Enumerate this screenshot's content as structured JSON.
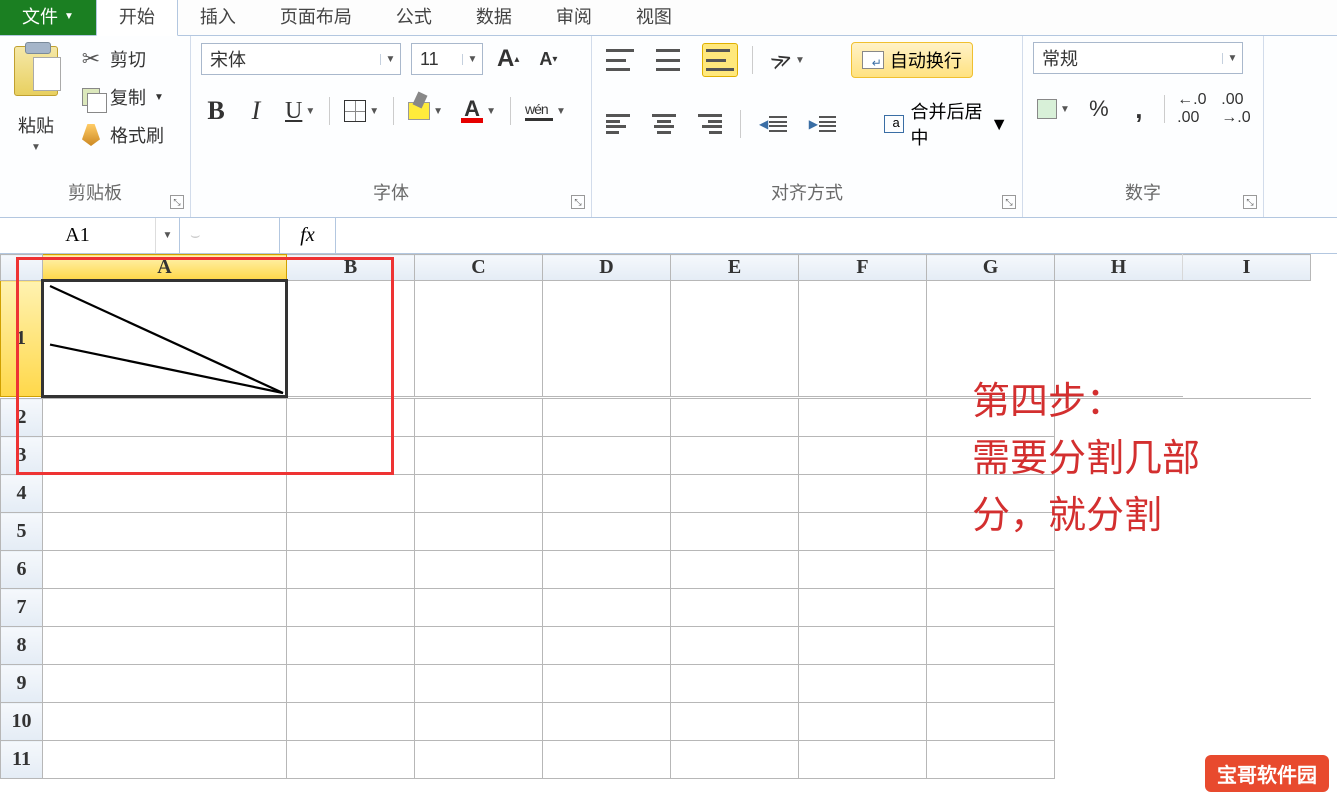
{
  "tabs": {
    "file": "文件",
    "items": [
      "开始",
      "插入",
      "页面布局",
      "公式",
      "数据",
      "审阅",
      "视图"
    ],
    "active_index": 0
  },
  "ribbon": {
    "clipboard": {
      "label": "剪贴板",
      "paste": "粘贴",
      "cut": "剪切",
      "copy": "复制",
      "format_painter": "格式刷"
    },
    "font": {
      "label": "字体",
      "name": "宋体",
      "size": "11",
      "bold": "B",
      "italic": "I",
      "underline": "U",
      "grow": "A",
      "shrink": "A",
      "fontcolor_letter": "A",
      "pinyin": "wén"
    },
    "align": {
      "label": "对齐方式",
      "wrap": "自动换行",
      "merge": "合并后居中"
    },
    "number": {
      "label": "数字",
      "format": "常规",
      "percent": "%",
      "comma": ",",
      "dec_inc": ".0 .00",
      "dec_dec": ".00 .0"
    }
  },
  "fxbar": {
    "namebox": "A1",
    "fx": "fx"
  },
  "grid": {
    "cols": [
      "A",
      "B",
      "C",
      "D",
      "E",
      "F",
      "G",
      "H",
      "I"
    ],
    "rows": [
      "1",
      "2",
      "3",
      "4",
      "5",
      "6",
      "7",
      "8",
      "9",
      "10",
      "11"
    ],
    "selected_cell": "A1"
  },
  "annotation": {
    "line1": "第四步：",
    "line2": "需要分割几部",
    "line3": "分，就分割"
  },
  "watermark": "宝哥软件园"
}
